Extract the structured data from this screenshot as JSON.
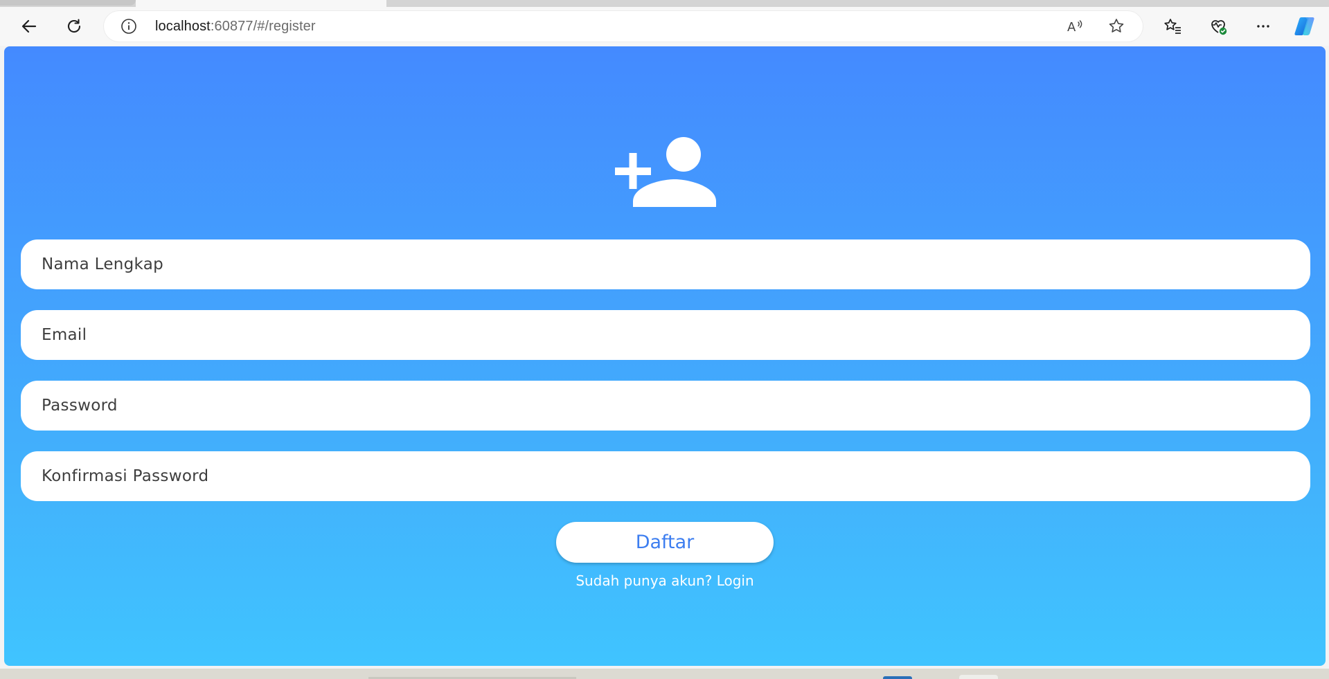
{
  "browser": {
    "url_host": "localhost",
    "url_rest": ":60877/#/register",
    "icons": {
      "back": "back-arrow-icon",
      "reload": "reload-icon",
      "info": "info-icon",
      "read_aloud": "read-aloud-icon",
      "favorite": "star-icon",
      "favorites_list": "favorites-icon",
      "browser_essentials": "heart-pulse-icon",
      "more": "more-icon",
      "copilot": "copilot-icon"
    }
  },
  "page": {
    "hero_icon": "person-add-icon",
    "fields": [
      {
        "placeholder": "Nama Lengkap",
        "value": ""
      },
      {
        "placeholder": "Email",
        "value": ""
      },
      {
        "placeholder": "Password",
        "value": ""
      },
      {
        "placeholder": "Konfirmasi Password",
        "value": ""
      }
    ],
    "submit_label": "Daftar",
    "login_link": "Sudah punya akun? Login"
  },
  "colors": {
    "gradient_top": "#448aff",
    "gradient_bottom": "#40c4ff",
    "button_text": "#3d7ef0",
    "field_bg": "#ffffff"
  }
}
